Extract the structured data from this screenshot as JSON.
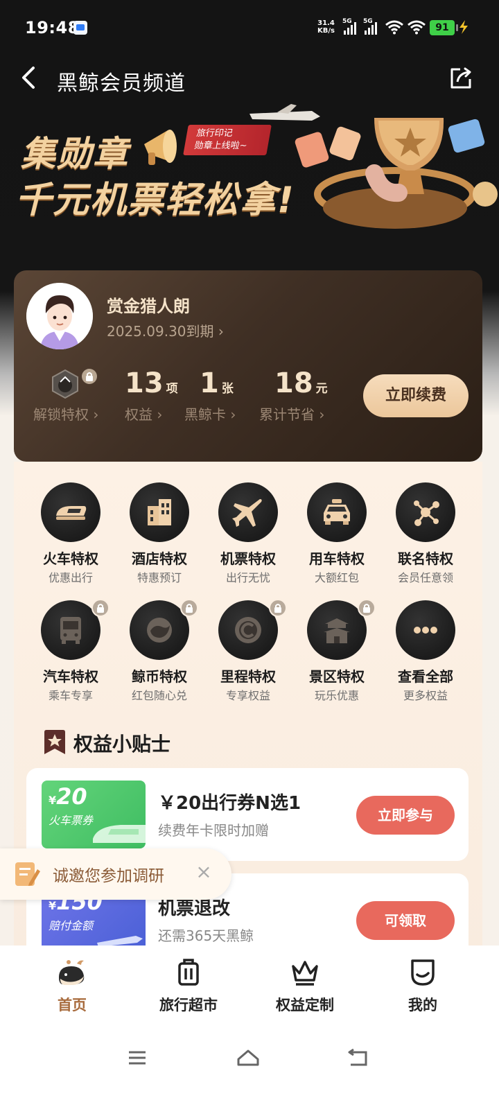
{
  "status_bar": {
    "time": "19:48",
    "net_speed_value": "31.4",
    "net_speed_unit": "KB/s",
    "signal1_label": "5G",
    "signal2_label": "5G",
    "battery": "91"
  },
  "header": {
    "title": "黑鲸会员频道",
    "back_icon": "back-arrow-icon",
    "share_icon": "share-icon"
  },
  "banner": {
    "line1": "集勋章",
    "line2": "千元机票轻松拿!",
    "tag_line1": "旅行印记",
    "tag_line2": "勋章上线啦~"
  },
  "member": {
    "name": "赏金猎人朗",
    "expiry": "2025.09.30到期",
    "stats": [
      {
        "label": "解锁特权"
      },
      {
        "num": "13",
        "unit": "项",
        "label": "权益"
      },
      {
        "num": "1",
        "unit": "张",
        "label": "黑鲸卡"
      },
      {
        "num": "18",
        "unit": "元",
        "label": "累计节省"
      }
    ],
    "renew_label": "立即续费"
  },
  "privileges": [
    {
      "title": "火车特权",
      "sub": "优惠出行",
      "icon": "train-icon",
      "locked": false
    },
    {
      "title": "酒店特权",
      "sub": "特惠预订",
      "icon": "hotel-icon",
      "locked": false
    },
    {
      "title": "机票特权",
      "sub": "出行无忧",
      "icon": "plane-icon",
      "locked": false
    },
    {
      "title": "用车特权",
      "sub": "大额红包",
      "icon": "car-icon",
      "locked": false
    },
    {
      "title": "联名特权",
      "sub": "会员任意领",
      "icon": "network-icon",
      "locked": false
    },
    {
      "title": "汽车特权",
      "sub": "乘车专享",
      "icon": "bus-icon",
      "locked": true
    },
    {
      "title": "鲸币特权",
      "sub": "红包随心兑",
      "icon": "coin-icon",
      "locked": true
    },
    {
      "title": "里程特权",
      "sub": "专享权益",
      "icon": "mileage-icon",
      "locked": true
    },
    {
      "title": "景区特权",
      "sub": "玩乐优惠",
      "icon": "scenic-gate-icon",
      "locked": true
    },
    {
      "title": "查看全部",
      "sub": "更多权益",
      "icon": "more-icon",
      "locked": false
    }
  ],
  "tips": {
    "heading": "权益小贴士",
    "cards": [
      {
        "coupon_currency": "¥",
        "coupon_amount": "20",
        "coupon_label": "火车票券",
        "title": "￥20出行券N选1",
        "sub": "续费年卡限时加赠",
        "button": "立即参与"
      },
      {
        "coupon_currency": "¥",
        "coupon_amount": "150",
        "coupon_label": "赔付金额",
        "title": "机票退改",
        "sub": "还需365天黑鲸",
        "button": "可领取"
      }
    ]
  },
  "survey": {
    "text": "诚邀您参加调研",
    "close": "×"
  },
  "bottom_nav": [
    {
      "label": "首页",
      "icon": "whale-home-icon",
      "active": true
    },
    {
      "label": "旅行超市",
      "icon": "suitcase-icon",
      "active": false
    },
    {
      "label": "权益定制",
      "icon": "crown-icon",
      "active": false
    },
    {
      "label": "我的",
      "icon": "smile-profile-icon",
      "active": false
    }
  ],
  "colors": {
    "accent": "#a86b3d",
    "button_red": "#e8695d",
    "card_dark": "#3f2f24",
    "gold_text": "#f5e3c9"
  }
}
